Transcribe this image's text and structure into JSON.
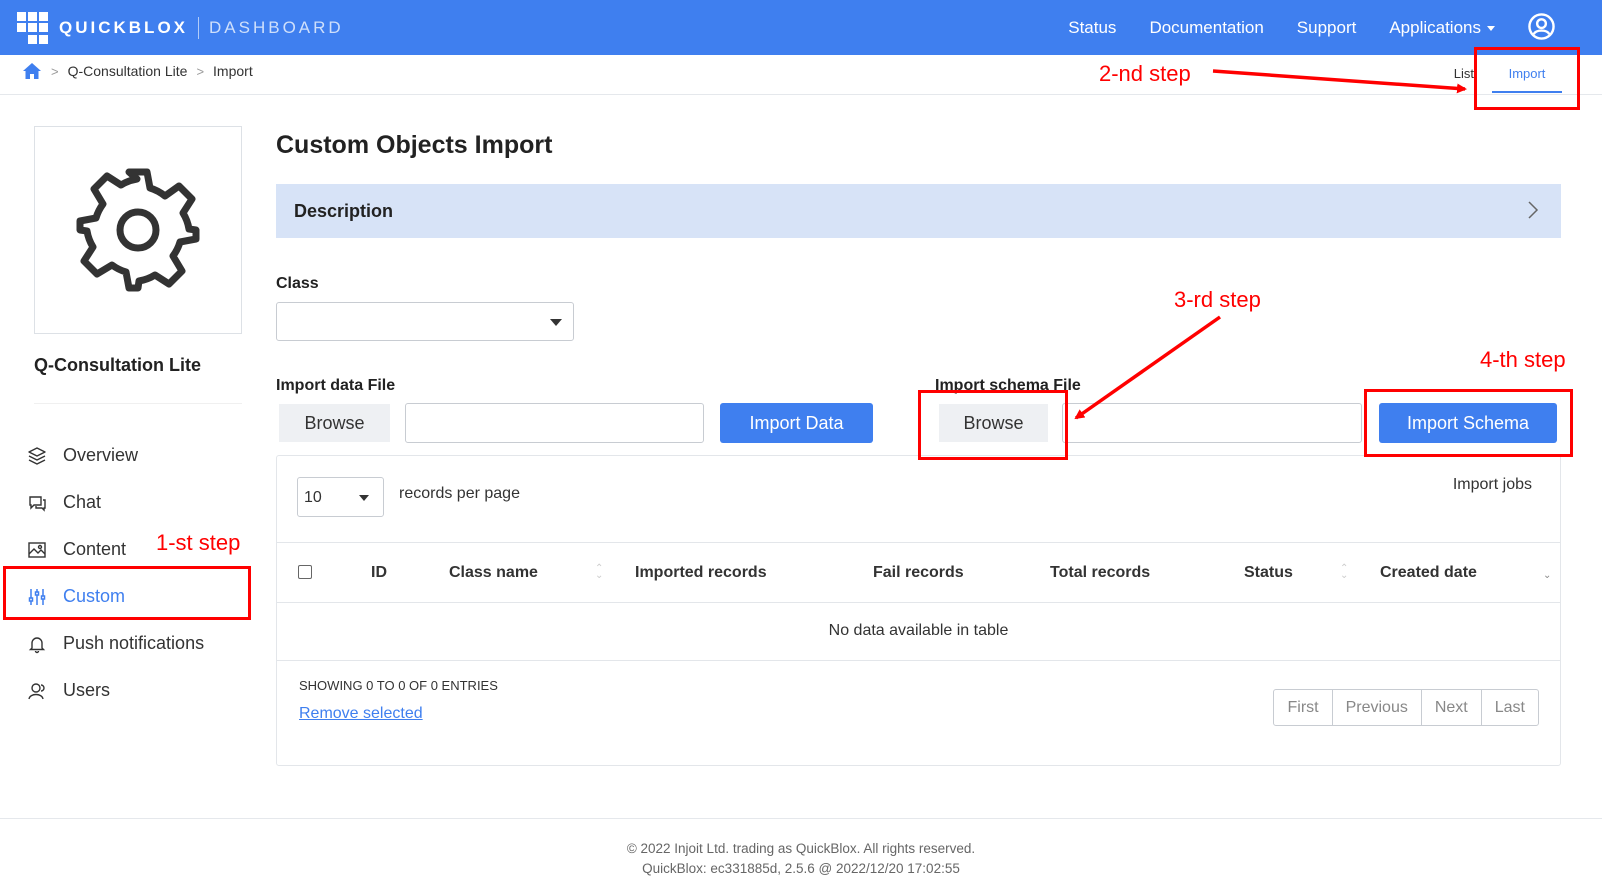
{
  "header": {
    "brand": "QUICKBLOX",
    "section": "DASHBOARD",
    "nav": [
      "Status",
      "Documentation",
      "Support",
      "Applications"
    ],
    "user_icon": "user-circle-icon"
  },
  "breadcrumb": {
    "home_icon": "home-icon",
    "items": [
      "Q-Consultation Lite",
      "Import"
    ]
  },
  "subtabs": {
    "list": "List",
    "import": "Import"
  },
  "sidebar": {
    "app_icon": "gear-icon",
    "app_name": "Q-Consultation Lite",
    "items": [
      {
        "label": "Overview",
        "icon": "layers-icon"
      },
      {
        "label": "Chat",
        "icon": "chat-icon"
      },
      {
        "label": "Content",
        "icon": "image-icon"
      },
      {
        "label": "Custom",
        "icon": "sliders-icon"
      },
      {
        "label": "Push notifications",
        "icon": "bell-icon"
      },
      {
        "label": "Users",
        "icon": "users-icon"
      }
    ]
  },
  "main": {
    "title": "Custom Objects Import",
    "description": "Description",
    "class_label": "Class",
    "class_value": "",
    "import_data_label": "Import data File",
    "import_schema_label": "Import schema File",
    "browse": "Browse",
    "import_data_button": "Import Data",
    "import_schema_button": "Import Schema"
  },
  "table": {
    "page_size": "10",
    "records_per_page": "records per page",
    "import_jobs": "Import jobs",
    "columns": [
      "ID",
      "Class name",
      "Imported records",
      "Fail records",
      "Total records",
      "Status",
      "Created date"
    ],
    "empty": "No data available in table",
    "showing": "SHOWING 0 TO 0 OF 0 ENTRIES",
    "remove_selected": "Remove selected",
    "pager": [
      "First",
      "Previous",
      "Next",
      "Last"
    ]
  },
  "footer": {
    "line1": "© 2022 Injoit Ltd. trading as QuickBlox. All rights reserved.",
    "line2": "QuickBlox: ec331885d, 2.5.6 @ 2022/12/20 17:02:55"
  },
  "annotations": [
    "1-st step",
    "2-nd step",
    "3-rd step",
    "4-th step"
  ],
  "colors": {
    "brand": "#3f7fef",
    "annotation": "#ff0000",
    "description_bg": "#d7e3f7"
  }
}
